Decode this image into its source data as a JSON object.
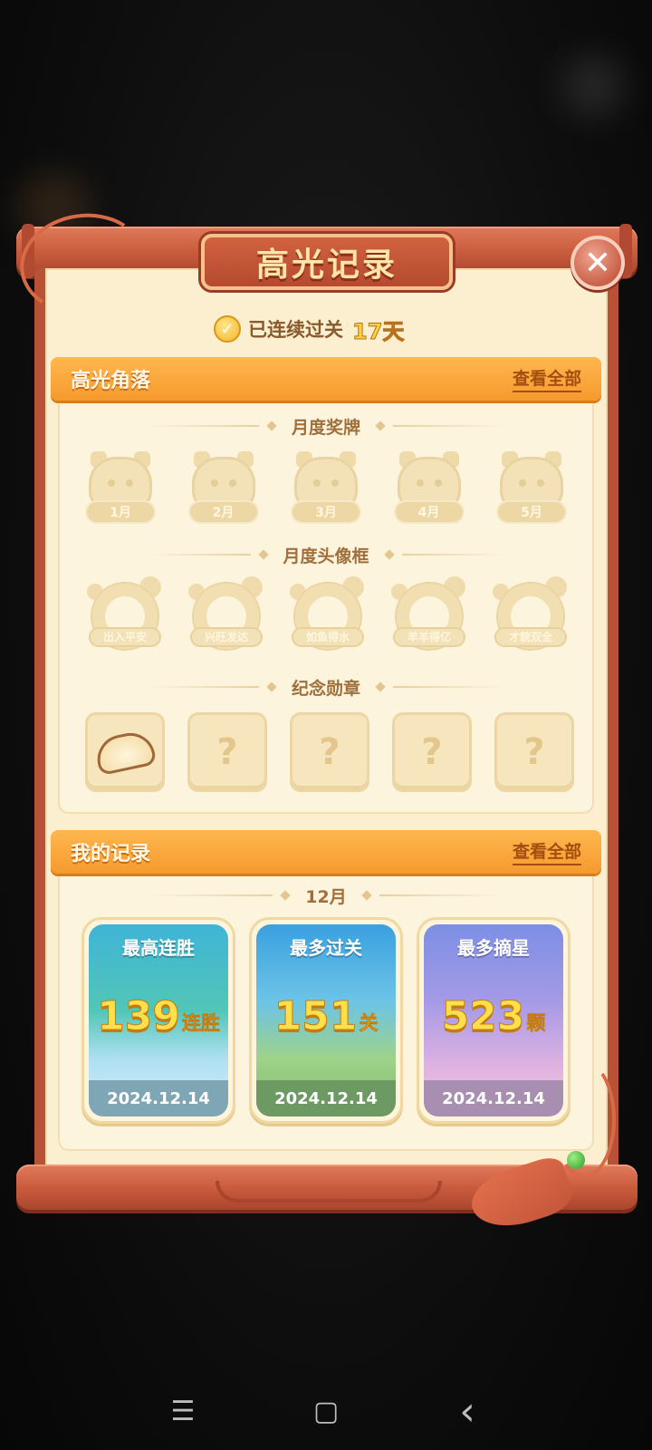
{
  "title": "高光记录",
  "close_label": "✕",
  "streak": {
    "text": "已连续过关",
    "days": "17天"
  },
  "highlights": {
    "title": "高光角落",
    "view_all": "查看全部",
    "medals": {
      "heading": "月度奖牌",
      "items": [
        "1月",
        "2月",
        "3月",
        "4月",
        "5月"
      ]
    },
    "frames": {
      "heading": "月度头像框",
      "items": [
        "出入平安",
        "兴旺发达",
        "如鱼得水",
        "羊羊得亿",
        "才貌双全"
      ]
    },
    "badges": {
      "heading": "纪念勋章",
      "items": [
        "dumpling",
        "?",
        "?",
        "?",
        "?"
      ]
    }
  },
  "records": {
    "title": "我的记录",
    "view_all": "查看全部",
    "month": "12月",
    "cards": [
      {
        "title": "最高连胜",
        "value": "139",
        "unit": "连胜",
        "date": "2024.12.14"
      },
      {
        "title": "最多过关",
        "value": "151",
        "unit": "关",
        "date": "2024.12.14"
      },
      {
        "title": "最多摘星",
        "value": "523",
        "unit": "颗",
        "date": "2024.12.14"
      }
    ]
  },
  "navbar": {
    "menu": "☰",
    "home": "▢",
    "back": "‹"
  },
  "colors": {
    "scroll": "#c85a3c",
    "paper": "#fbefcf",
    "header": "#f69a2d",
    "accent_gold": "#ffd23e"
  }
}
